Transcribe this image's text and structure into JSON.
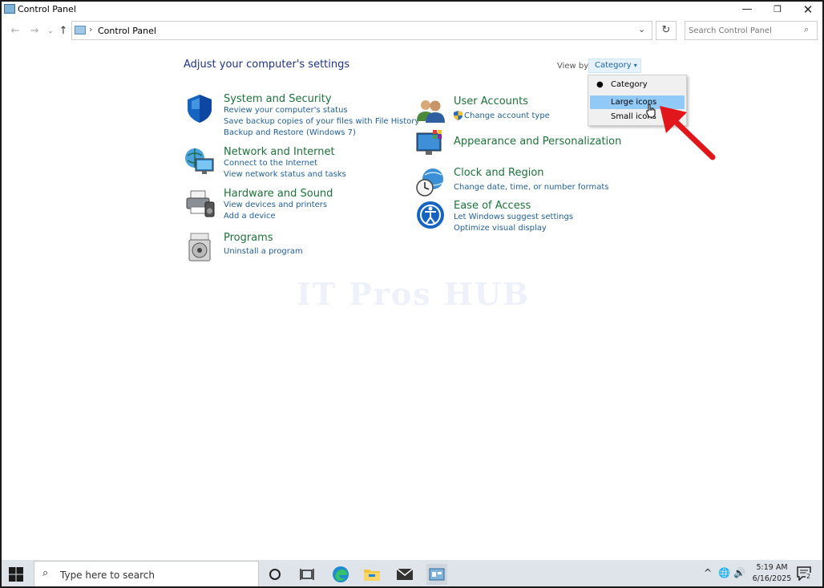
{
  "window": {
    "title": "Control Panel",
    "minimize": "—",
    "maximize": "❐",
    "close": "✕"
  },
  "nav": {
    "back": "←",
    "forward": "→",
    "recent": "⌄",
    "up": "↑",
    "breadcrumb_separator": "›",
    "breadcrumb": "Control Panel",
    "address_dropdown": "⌄",
    "refresh": "↻",
    "search_placeholder": "Search Control Panel",
    "search_icon": "⌕"
  },
  "main": {
    "heading": "Adjust your computer's settings",
    "view_by_label": "View by:",
    "view_by_value": "Category",
    "view_by_caret": "▾"
  },
  "categories_left": [
    {
      "title": "System and Security",
      "icon": "shield-icon",
      "links": [
        "Review your computer's status",
        "Save backup copies of your files with File History",
        "Backup and Restore (Windows 7)"
      ]
    },
    {
      "title": "Network and Internet",
      "icon": "network-globe-icon",
      "links": [
        "Connect to the Internet",
        "View network status and tasks"
      ]
    },
    {
      "title": "Hardware and Sound",
      "icon": "printer-speaker-icon",
      "links": [
        "View devices and printers",
        "Add a device"
      ]
    },
    {
      "title": "Programs",
      "icon": "programs-disc-icon",
      "links": [
        "Uninstall a program"
      ]
    }
  ],
  "categories_right": [
    {
      "title": "User Accounts",
      "icon": "users-icon",
      "links": [
        "Change account type"
      ]
    },
    {
      "title": "Appearance and Personalization",
      "icon": "monitor-palette-icon",
      "links": []
    },
    {
      "title": "Clock and Region",
      "icon": "clock-globe-icon",
      "links": [
        "Change date, time, or number formats"
      ]
    },
    {
      "title": "Ease of Access",
      "icon": "ease-of-access-icon",
      "links": [
        "Let Windows suggest settings",
        "Optimize visual display"
      ]
    }
  ],
  "watermark": "IT Pros HUB",
  "view_menu": {
    "items": [
      "Category",
      "Large icons",
      "Small icons"
    ],
    "selected": "Category",
    "highlighted": "Large icons",
    "bullet": "●"
  },
  "taskbar": {
    "search_placeholder": "Type here to search",
    "search_icon": "⌕",
    "apps": [
      "cortana-circle-icon",
      "task-view-icon",
      "edge-icon",
      "file-explorer-icon",
      "mail-icon",
      "control-panel-icon"
    ],
    "tray_chevron": "^",
    "tray_network": "🌐",
    "tray_volume": "🔊",
    "time": "5:19 AM",
    "date": "6/16/2025",
    "notifications": "2"
  },
  "colors": {
    "category_title": "#1b7339",
    "link": "#1f5f9a",
    "heading": "#1e3287",
    "menu_highlight": "#91c9f7",
    "arrow": "#e0161b"
  }
}
